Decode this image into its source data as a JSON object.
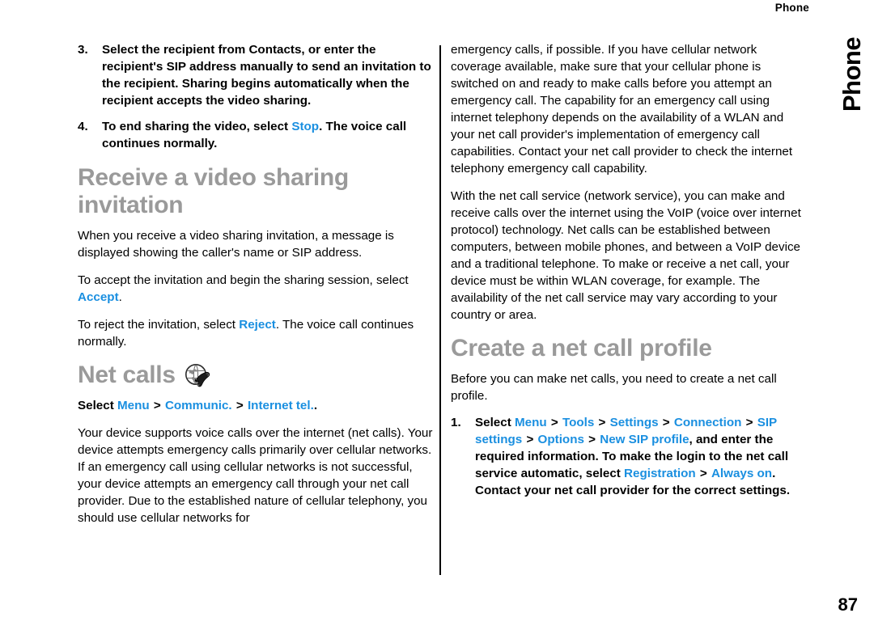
{
  "header": {
    "running_head": "Phone",
    "thumb_tab": "Phone"
  },
  "footer": {
    "page_number": "87"
  },
  "colors": {
    "ui_term": "#1a8fe0",
    "heading": "#9a9a9a",
    "body": "#000000"
  },
  "left_column": {
    "steps_continued": [
      {
        "number": "3.",
        "parts": [
          {
            "type": "text",
            "value": "Select the recipient from Contacts, or enter the recipient's SIP address manually to send an invitation to the recipient. Sharing begins automatically when the recipient accepts the video sharing."
          }
        ]
      },
      {
        "number": "4.",
        "parts": [
          {
            "type": "text",
            "value": "To end sharing the video, select "
          },
          {
            "type": "ui",
            "value": "Stop"
          },
          {
            "type": "text",
            "value": ". The voice call continues normally."
          }
        ]
      }
    ],
    "heading_receive": "Receive a video sharing invitation",
    "para_receive_1": "When you receive a video sharing invitation, a message is displayed showing the caller's name or SIP address.",
    "para_accept": {
      "before": "To accept the invitation and begin the sharing session, select ",
      "term": "Accept",
      "after": "."
    },
    "para_reject": {
      "before": "To reject the invitation, select ",
      "term": "Reject",
      "after": ". The voice call continues normally."
    },
    "heading_net_calls": "Net calls",
    "net_calls_icon": "globe-phone-icon",
    "selector": {
      "lead": "Select ",
      "terms": [
        "Menu",
        "Communic.",
        "Internet tel."
      ],
      "separator": ">",
      "trailing": "."
    },
    "para_net_calls": "Your device supports voice calls over the internet (net calls). Your device attempts emergency calls primarily over cellular networks. If an emergency call using cellular networks is not successful, your device attempts an emergency call through your net call provider. Due to the established nature of cellular telephony, you should use cellular networks for"
  },
  "right_column": {
    "para_continued": "emergency calls, if possible. If you have cellular network coverage available, make sure that your cellular phone is switched on and ready to make calls before you attempt an emergency call. The capability for an emergency call using internet telephony depends on the availability of a WLAN and your net call provider's implementation of emergency call capabilities. Contact your net call provider to check the internet telephony emergency call capability.",
    "para_voip": "With the net call service (network service), you can make and receive calls over the internet using the VoIP (voice over internet protocol) technology. Net calls can be established between computers, between mobile phones, and between a VoIP device and a traditional telephone. To make or receive a net call, your device must be within WLAN coverage, for example. The availability of the net call service may vary according to your country or area.",
    "heading_create_profile": "Create a net call profile",
    "para_before_profile": "Before you can make net calls, you need to create a net call profile.",
    "step_1": {
      "number": "1.",
      "lead": "Select ",
      "path_terms": [
        "Menu",
        "Tools",
        "Settings",
        "Connection",
        "SIP settings",
        "Options",
        "New SIP profile"
      ],
      "separator": ">",
      "middle": ", and enter the required information. To make the login to the net call service automatic, select ",
      "registration_terms": [
        "Registration",
        "Always on"
      ],
      "tail": ". Contact your net call provider for the correct settings."
    }
  }
}
